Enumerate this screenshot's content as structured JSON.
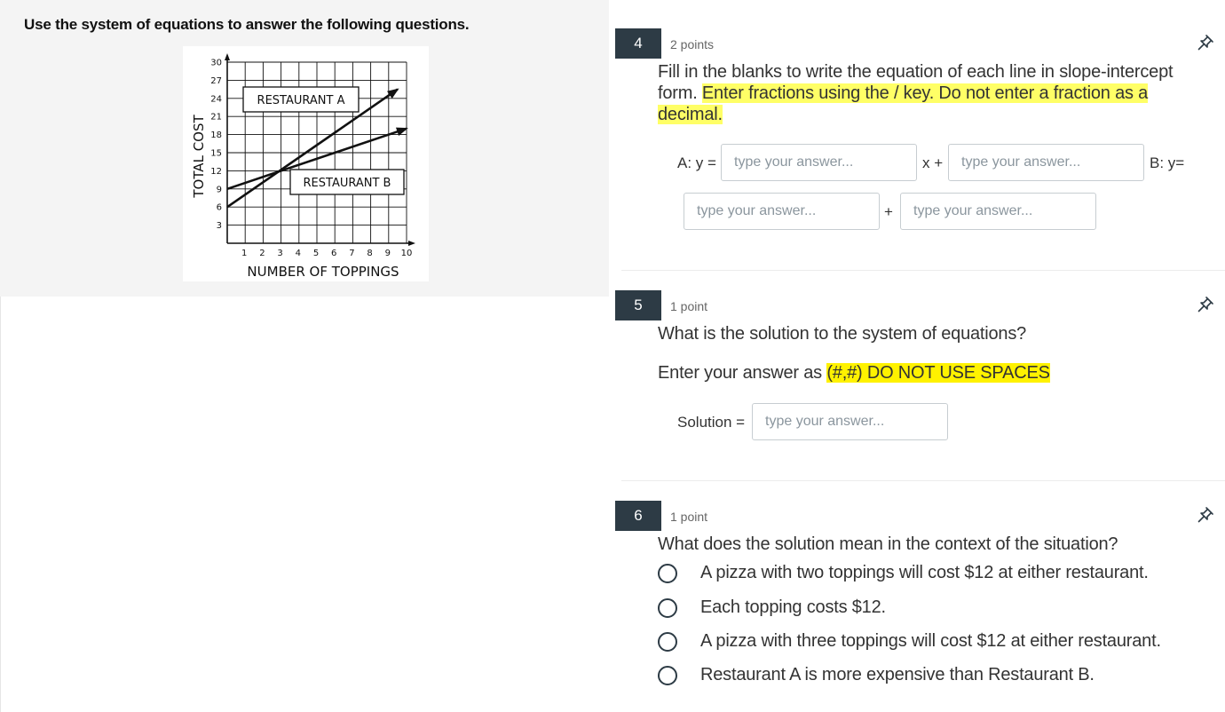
{
  "stimulus": {
    "instructions": "Use the system of equations to answer the following questions.",
    "graph": {
      "y_axis_label": "TOTAL COST",
      "x_axis_label": "NUMBER OF TOPPINGS",
      "y_ticks": [
        "3",
        "6",
        "9",
        "12",
        "15",
        "18",
        "21",
        "24",
        "27",
        "30"
      ],
      "x_ticks": [
        "1",
        "2",
        "3",
        "4",
        "5",
        "6",
        "7",
        "8",
        "9",
        "10"
      ],
      "line_a_label": "RESTAURANT A",
      "line_b_label": "RESTAURANT B",
      "line_a": {
        "x": [
          0,
          9.5
        ],
        "y": [
          6,
          25.5
        ]
      },
      "line_b": {
        "x": [
          0,
          10
        ],
        "y": [
          9,
          19
        ]
      },
      "xlim": [
        0,
        10
      ],
      "ylim": [
        0,
        30
      ]
    }
  },
  "questions": [
    {
      "number": "4",
      "points": "2 points",
      "text_plain": "Fill in the blanks to write the equation of each line in slope-intercept form. ",
      "text_highlight": "Enter fractions using the / key. Do not enter a fraction as a decimal.",
      "labels": {
        "a_y": "A: y =",
        "x_plus_1": "x +",
        "b_y": "B: y=",
        "plus_2": "+"
      },
      "placeholder": "type your answer..."
    },
    {
      "number": "5",
      "points": "1 point",
      "text": "What is the solution to the system of equations?",
      "instr_plain": "Enter your answer as ",
      "instr_highlight": "(#,#) DO NOT USE SPACES",
      "solution_label": "Solution =",
      "placeholder": "type your answer..."
    },
    {
      "number": "6",
      "points": "1 point",
      "text": "What does the solution mean in the context of the situation?",
      "choices": [
        "A pizza with two toppings will cost $12 at either restaurant.",
        "Each topping costs $12.",
        "A pizza with three toppings will cost $12 at either restaurant.",
        "Restaurant A is more expensive than Restaurant B."
      ]
    }
  ],
  "colors": {
    "question_number_bg": "#2d3b45",
    "highlight": "#ffff66",
    "highlight_strong": "#fff200",
    "left_panel_bg": "#f4f4f4"
  },
  "icons": {
    "pin": "pin-icon"
  }
}
